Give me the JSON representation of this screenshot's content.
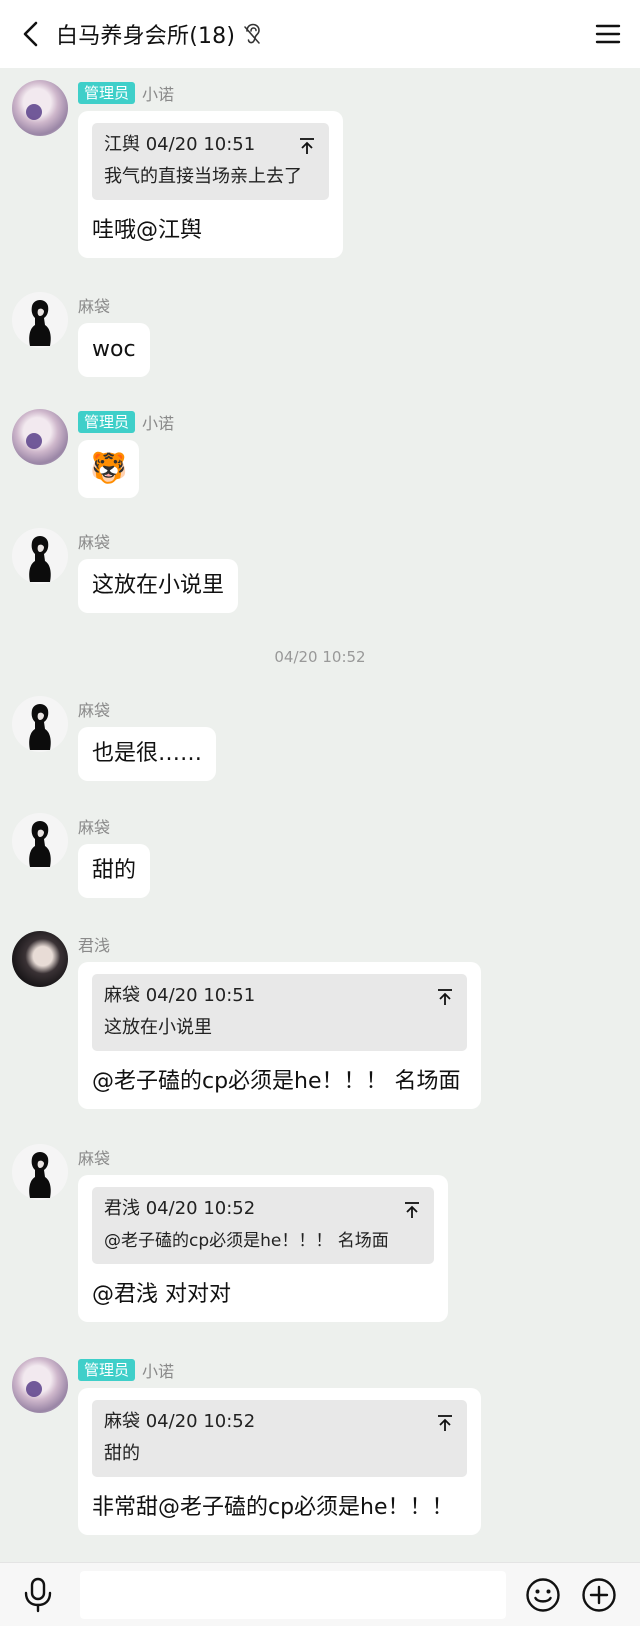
{
  "header": {
    "title": "白马养身会所(18)",
    "back_icon": "chevron-left-icon",
    "ear_icon": "ear-icon",
    "menu_icon": "hamburger-menu-icon"
  },
  "colors": {
    "background": "#edf0ed",
    "admin_badge": "#3fcfc9",
    "bubble": "#ffffff",
    "quote": "#e8e8e8"
  },
  "timestamp_divider": "04/20 10:52",
  "messages": [
    {
      "sender": "小诺",
      "badge": "管理员",
      "quote": {
        "header": "江舆 04/20 10:51",
        "body": "我气的直接当场亲上去了"
      },
      "text": "哇哦@江舆"
    },
    {
      "sender": "麻袋",
      "text": "woc"
    },
    {
      "sender": "小诺",
      "badge": "管理员",
      "sticker": "🐯"
    },
    {
      "sender": "麻袋",
      "text": "这放在小说里"
    },
    {
      "sender": "麻袋",
      "text": "也是很……"
    },
    {
      "sender": "麻袋",
      "text": "甜的"
    },
    {
      "sender": "君浅",
      "quote": {
        "header": "麻袋 04/20 10:51",
        "body": "这放在小说里"
      },
      "text": "@老子磕的cp必须是he！！！ 名场面"
    },
    {
      "sender": "麻袋",
      "quote": {
        "header": "君浅 04/20 10:52",
        "body": "@老子磕的cp必须是he！！！ 名场面"
      },
      "text": "@君浅 对对对"
    },
    {
      "sender": "小诺",
      "badge": "管理员",
      "quote": {
        "header": "麻袋 04/20 10:52",
        "body": "甜的"
      },
      "text": "非常甜@老子磕的cp必须是he！！！"
    }
  ],
  "input_bar": {
    "mic_icon": "microphone-icon",
    "input_placeholder": "",
    "emoji_icon": "smiley-icon",
    "plus_icon": "plus-circle-icon"
  }
}
